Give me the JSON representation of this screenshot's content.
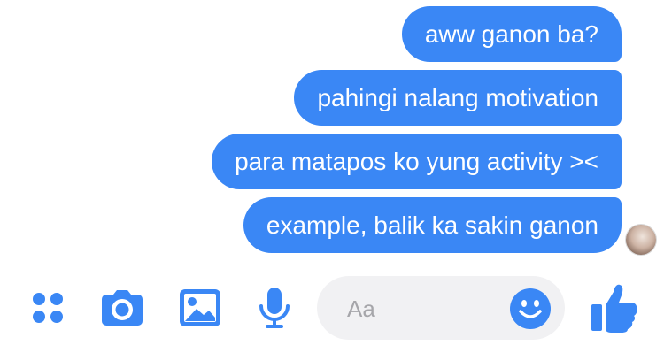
{
  "conversation": {
    "messages": [
      {
        "text": "aww ganon ba?"
      },
      {
        "text": "pahingi nalang motivation"
      },
      {
        "text": "para matapos ko yung activity ><"
      },
      {
        "text": "example, balik ka sakin ganon"
      }
    ]
  },
  "composer": {
    "placeholder": "Aa",
    "icons": [
      "more-apps-icon",
      "camera-icon",
      "gallery-icon",
      "microphone-icon",
      "emoji-icon",
      "thumbs-up-icon"
    ]
  },
  "theme": {
    "accent": "#3a87f5",
    "input_bg": "#f1f1f3"
  }
}
